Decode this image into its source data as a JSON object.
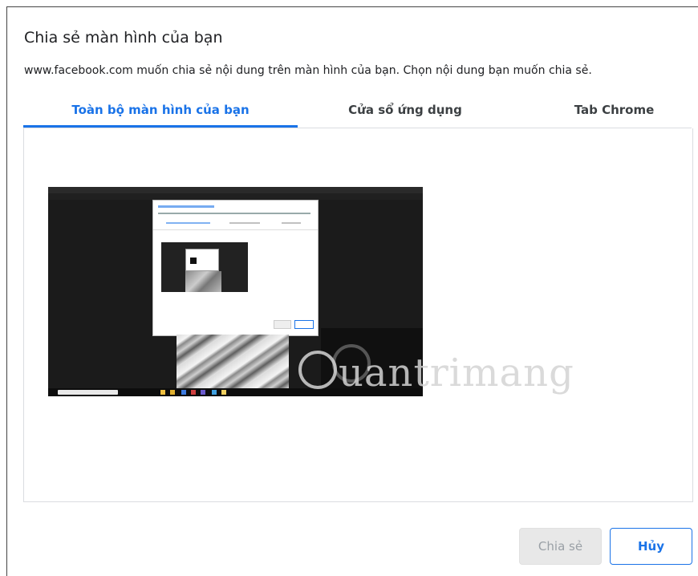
{
  "dialog": {
    "title": "Chia sẻ màn hình của bạn",
    "description": "www.facebook.com muốn chia sẻ nội dung trên màn hình của bạn. Chọn nội dung bạn muốn chia sẻ."
  },
  "tabs": [
    {
      "label": "Toàn bộ màn hình của bạn",
      "active": true
    },
    {
      "label": "Cửa sổ ứng dụng",
      "active": false
    },
    {
      "label": "Tab Chrome",
      "active": false
    }
  ],
  "preview": {
    "icon": "screen-thumbnail",
    "selected": false
  },
  "watermark": {
    "text": "uantrimang"
  },
  "buttons": {
    "share_label": "Chia sẻ",
    "cancel_label": "Hủy"
  },
  "colors": {
    "accent": "#1a73e8",
    "disabled_bg": "#e8e8e8",
    "text": "#202124"
  }
}
